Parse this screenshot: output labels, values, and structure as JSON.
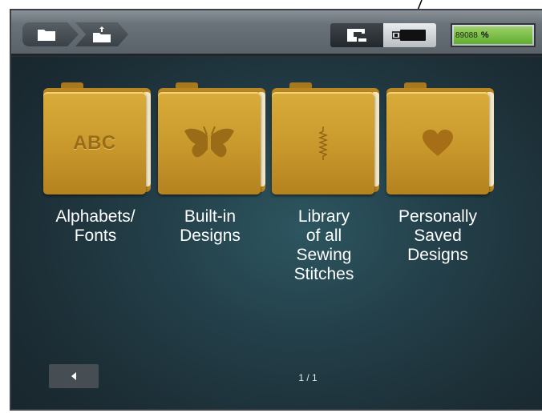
{
  "toolbar": {
    "breadcrumb": [
      {
        "icon": "folder-icon"
      },
      {
        "icon": "folder-upload-icon"
      }
    ],
    "modes": [
      {
        "icon": "sewing-machine-icon",
        "active": false
      },
      {
        "icon": "usb-stick-icon",
        "active": true
      }
    ],
    "storage": {
      "value": "89088",
      "unit": "%",
      "fill_color": "#6bb83a"
    }
  },
  "folders": [
    {
      "icon": "abc-text-icon",
      "icon_text": "ABC",
      "label": "Alphabets/\nFonts"
    },
    {
      "icon": "butterfly-icon",
      "label": "Built-in\nDesigns"
    },
    {
      "icon": "zigzag-stitch-icon",
      "label": "Library\nof all\nSewing\nStitches"
    },
    {
      "icon": "heart-icon",
      "label": "Personally\nSaved\nDesigns"
    }
  ],
  "footer": {
    "prev_icon": "triangle-left-icon",
    "page_indicator": "1 / 1"
  },
  "colors": {
    "background": "#1f3a44",
    "folder": "#c8982c",
    "label_text": "#ffffff"
  }
}
